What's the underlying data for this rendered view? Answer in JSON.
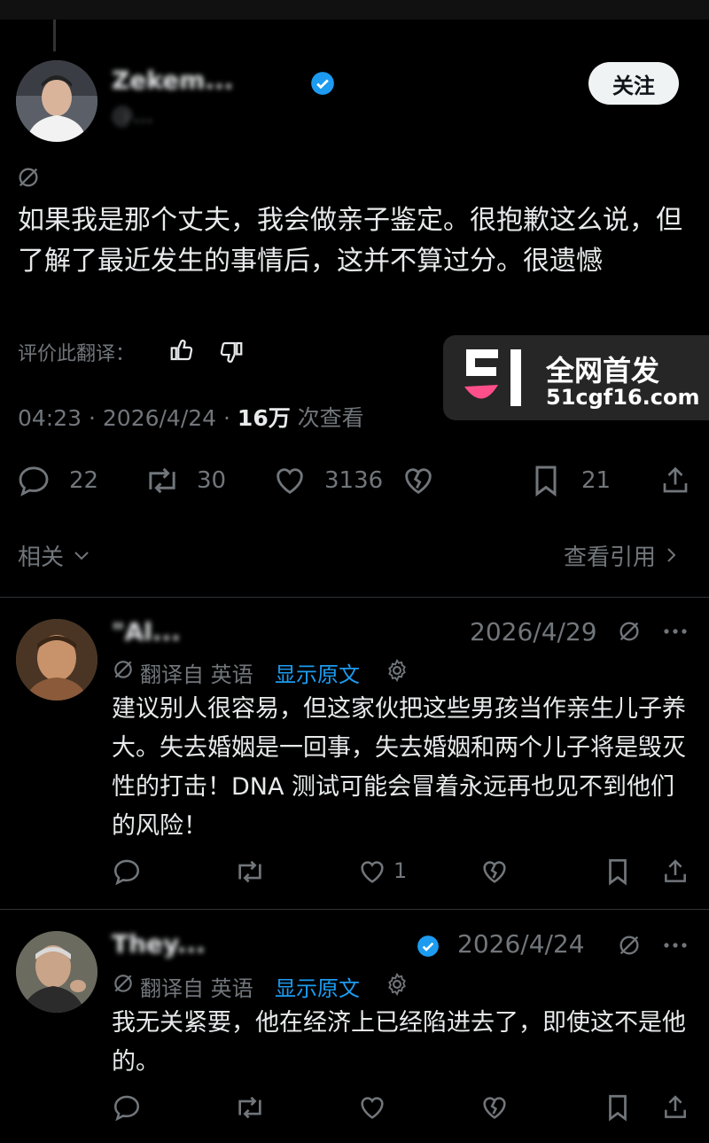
{
  "main_post": {
    "author_name": "Zekem...",
    "handle": "@...",
    "follow_label": "关注",
    "text": "如果我是那个丈夫，我会做亲子鉴定。很抱歉这么说，但了解了最近发生的事情后，这并不算过分。很遗憾",
    "rate_label": "评价此翻译：",
    "time": "04:23 · 2026/4/24 · ",
    "views_count": "16万",
    "views_label": " 次查看",
    "replies": "22",
    "reposts": "30",
    "likes": "3136",
    "bookmarks": "21"
  },
  "related": {
    "label": "相关",
    "quotes_label": "查看引用"
  },
  "watermark": {
    "title": "全网首发",
    "url": "51cgf16.com",
    "logo_text": "51"
  },
  "replies": [
    {
      "author": "\"Al...",
      "date": "2026/4/29",
      "translated_from": "翻译自 英语",
      "show_original": "显示原文",
      "text": "建议别人很容易，但这家伙把这些男孩当作亲生儿子养大。失去婚姻是一回事，失去婚姻和两个儿子将是毁灭性的打击！DNA 测试可能会冒着永远再也见不到他们的风险！",
      "likes": "1"
    },
    {
      "author": "They...",
      "date": "2026/4/24",
      "translated_from": "翻译自 英语",
      "show_original": "显示原文",
      "text": "我无关紧要，他在经济上已经陷进去了，即使这不是他的。",
      "likes": ""
    }
  ],
  "colors": {
    "background": "#000000",
    "text": "#e7e9ea",
    "muted": "#71767b",
    "link": "#1d9bf0",
    "verified": "#1d9bf0",
    "follow_bg": "#eff3f4"
  }
}
